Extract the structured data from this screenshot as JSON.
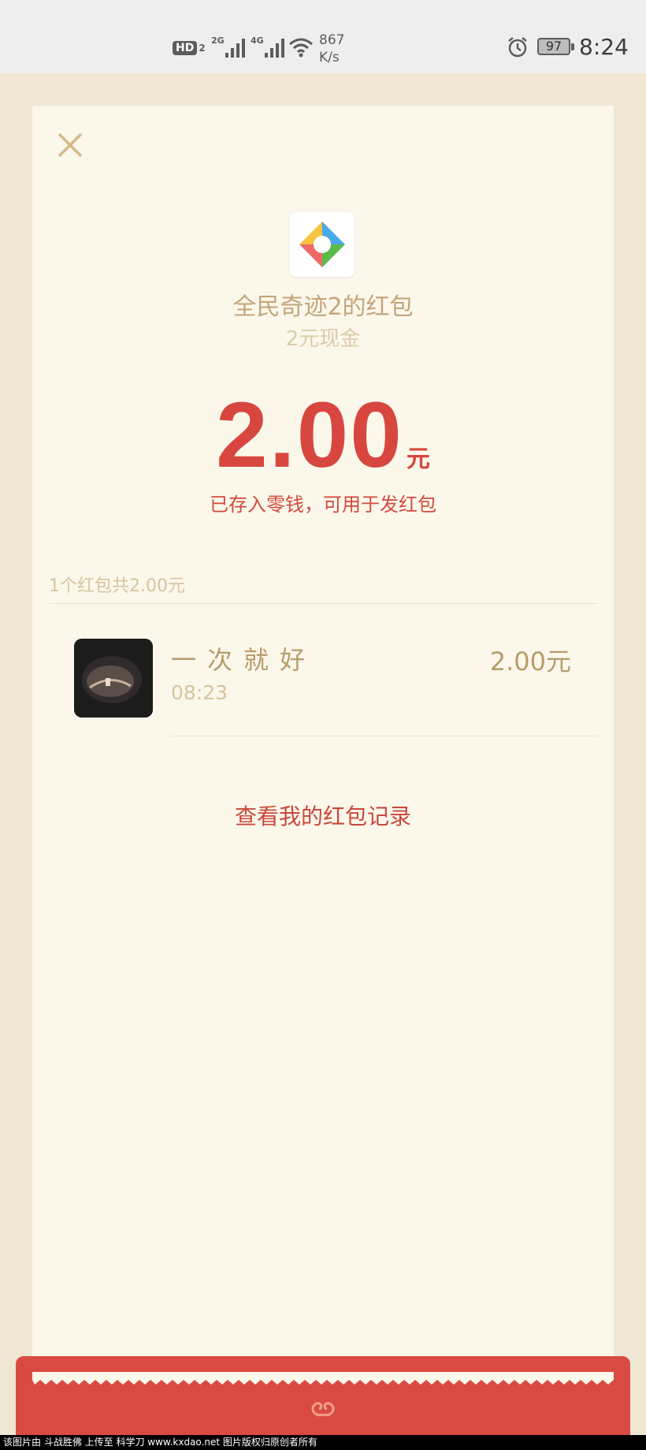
{
  "status_bar": {
    "hd_label": "HD",
    "hd_sim": "2",
    "sim1_network": "2G",
    "sim2_network": "4G",
    "speed_value": "867",
    "speed_unit": "K/s",
    "battery_level": "97",
    "time": "8:24"
  },
  "redpacket": {
    "sender_title": "全民奇迹2的红包",
    "subtitle": "2元现金",
    "amount": "2.00",
    "amount_unit": "元",
    "note": "已存入零钱，可用于发红包",
    "summary": "1个红包共2.00元",
    "records": [
      {
        "nickname": "一次就好",
        "time": "08:23",
        "amount": "2.00元"
      }
    ],
    "view_records_link": "查看我的红包记录"
  },
  "colors": {
    "accent_red": "#d8473f",
    "gold_text": "#b79d6c",
    "card_bg": "#fcf7eb",
    "page_bg": "#efe6d4"
  },
  "icons": {
    "close": "close-icon",
    "app": "app-logo-icon",
    "footer": "redpacket-footer-logo-icon"
  },
  "watermark": "该图片由 斗战胜佛 上传至 科学刀 www.kxdao.net 图片版权归原创者所有"
}
